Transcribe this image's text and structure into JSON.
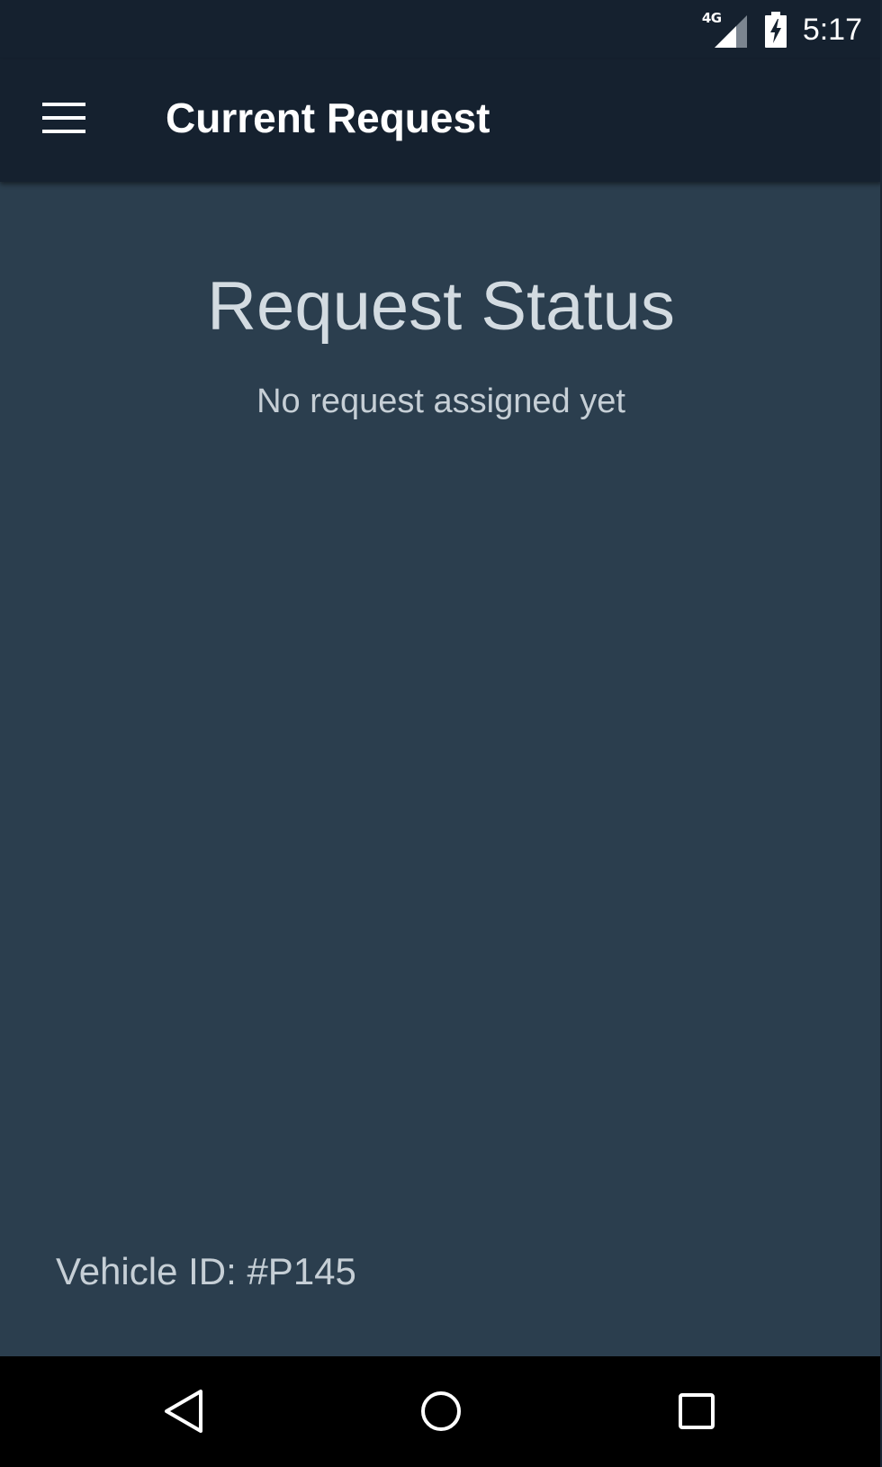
{
  "status_bar": {
    "network_type": "4G",
    "time": "5:17",
    "icons": {
      "signal": "cell-signal-icon",
      "battery": "battery-charging-icon"
    }
  },
  "toolbar": {
    "menu_icon": "hamburger-menu-icon",
    "title": "Current Request"
  },
  "main": {
    "heading": "Request Status",
    "status_message": "No request assigned yet",
    "vehicle_id": "Vehicle ID: #P145"
  },
  "nav_bar": {
    "icons": [
      "back-icon",
      "home-icon",
      "recents-icon"
    ]
  },
  "colors": {
    "toolbar_bg": "#15212f",
    "content_bg": "#2b3e4e",
    "heading_text": "#d3dbe1",
    "body_text": "#c6cfd6",
    "nav_bg": "#000000"
  }
}
